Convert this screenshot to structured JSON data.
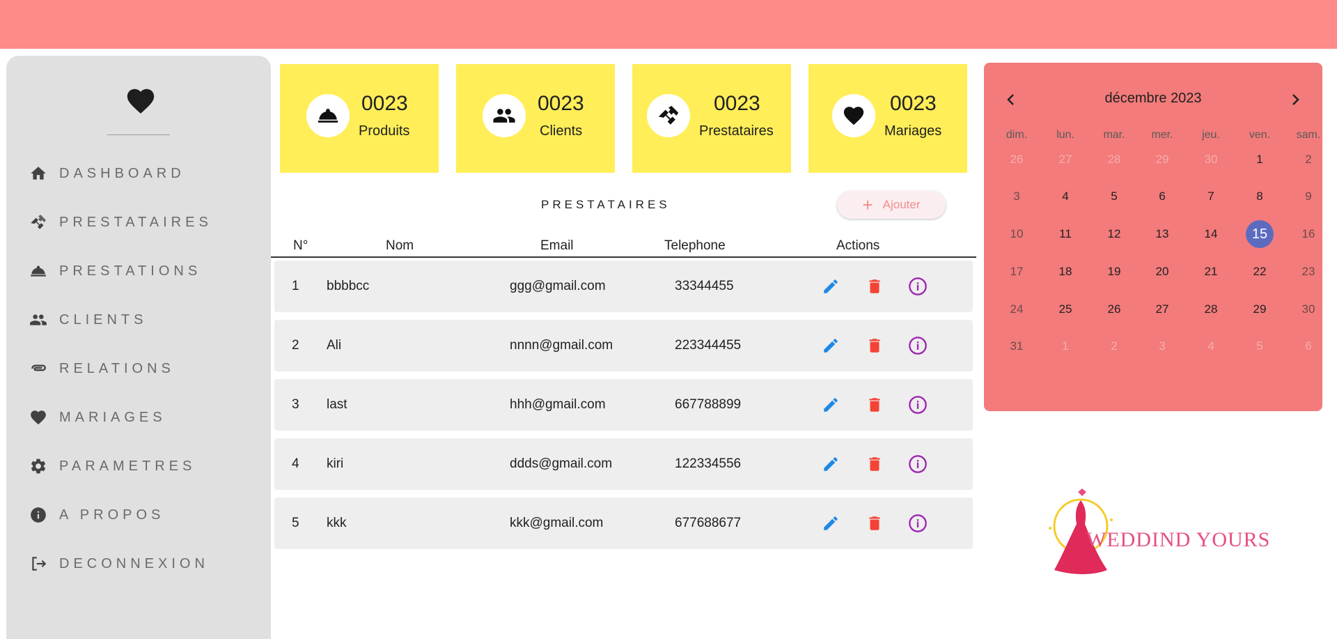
{
  "sidebar": {
    "items": [
      {
        "label": "DASHBOARD",
        "icon": "home-icon"
      },
      {
        "label": "PRESTATAIRES",
        "icon": "handshake-icon"
      },
      {
        "label": "PRESTATIONS",
        "icon": "cloche-icon"
      },
      {
        "label": "CLIENTS",
        "icon": "people-icon"
      },
      {
        "label": "RELATIONS",
        "icon": "paperclip-icon"
      },
      {
        "label": "MARIAGES",
        "icon": "heart-icon"
      },
      {
        "label": "PARAMETRES",
        "icon": "gear-icon"
      },
      {
        "label": "A PROPOS",
        "icon": "info-icon"
      },
      {
        "label": "DECONNEXION",
        "icon": "logout-icon"
      }
    ]
  },
  "stats": [
    {
      "value": "0023",
      "label": "Produits",
      "icon": "cloche-icon"
    },
    {
      "value": "0023",
      "label": "Clients",
      "icon": "people-icon"
    },
    {
      "value": "0023",
      "label": "Prestataires",
      "icon": "handshake-icon"
    },
    {
      "value": "0023",
      "label": "Mariages",
      "icon": "heart-icon"
    }
  ],
  "table": {
    "title": "PRESTATAIRES",
    "add_label": "Ajouter",
    "headers": {
      "num": "N°",
      "nom": "Nom",
      "email": "Email",
      "telephone": "Telephone",
      "actions": "Actions"
    },
    "rows": [
      {
        "num": "1",
        "nom": "bbbbcc",
        "email": "ggg@gmail.com",
        "telephone": "33344455"
      },
      {
        "num": "2",
        "nom": "Ali",
        "email": "nnnn@gmail.com",
        "telephone": "223344455"
      },
      {
        "num": "3",
        "nom": "last",
        "email": "hhh@gmail.com",
        "telephone": "667788899"
      },
      {
        "num": "4",
        "nom": "kiri",
        "email": "ddds@gmail.com",
        "telephone": "122334556"
      },
      {
        "num": "5",
        "nom": "kkk",
        "email": "kkk@gmail.com",
        "telephone": "677688677"
      }
    ]
  },
  "calendar": {
    "title": "décembre 2023",
    "weekdays": [
      "dim.",
      "lun.",
      "mar.",
      "mer.",
      "jeu.",
      "ven.",
      "sam."
    ],
    "weeks": [
      [
        "26",
        "27",
        "28",
        "29",
        "30",
        "1",
        "2"
      ],
      [
        "3",
        "4",
        "5",
        "6",
        "7",
        "8",
        "9"
      ],
      [
        "10",
        "11",
        "12",
        "13",
        "14",
        "15",
        "16"
      ],
      [
        "17",
        "18",
        "19",
        "20",
        "21",
        "22",
        "23"
      ],
      [
        "24",
        "25",
        "26",
        "27",
        "28",
        "29",
        "30"
      ],
      [
        "31",
        "1",
        "2",
        "3",
        "4",
        "5",
        "6"
      ]
    ],
    "selected": "15"
  },
  "brand": {
    "text": "WEDDIND YOURS"
  },
  "colors": {
    "topbar": "#ff8a8a",
    "sidebar": "#e0e0e0",
    "card": "#ffee58",
    "calendar": "#f37b7b",
    "selected_day": "#5c6bc0",
    "edit": "#1e88e5",
    "delete": "#f44336",
    "info": "#9c27b0"
  }
}
